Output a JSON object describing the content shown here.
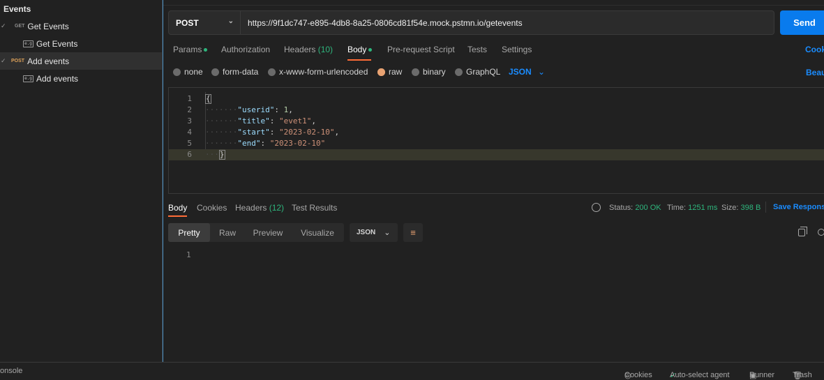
{
  "sidebar": {
    "collection_title": "Events",
    "items": [
      {
        "method": "GET",
        "label": "Get Events"
      },
      {
        "example_icon": "e.g",
        "label": "Get Events"
      },
      {
        "method": "POST",
        "label": "Add events"
      },
      {
        "example_icon": "e.g",
        "label": "Add events"
      }
    ]
  },
  "request": {
    "method": "POST",
    "url": "https://9f1dc747-e895-4db8-8a25-0806cd81f54e.mock.pstmn.io/getevents",
    "send_label": "Send"
  },
  "request_tabs": {
    "params": "Params",
    "authorization": "Authorization",
    "headers": "Headers",
    "headers_count": "(10)",
    "body": "Body",
    "pre_request": "Pre-request Script",
    "tests": "Tests",
    "settings": "Settings",
    "cookies_link": "Cooki"
  },
  "body_types": {
    "none": "none",
    "form_data": "form-data",
    "urlencoded": "x-www-form-urlencoded",
    "raw": "raw",
    "binary": "binary",
    "graphql": "GraphQL",
    "format": "JSON",
    "beautify_link": "Beau"
  },
  "editor": {
    "line_numbers": [
      "1",
      "2",
      "3",
      "4",
      "5",
      "6"
    ],
    "lines": [
      {
        "open": "{"
      },
      {
        "key": "\"userid\"",
        "sep": ": ",
        "value": "1",
        "type": "num",
        "trail": ","
      },
      {
        "key": "\"title\"",
        "sep": ": ",
        "value": "\"evet1\"",
        "type": "str",
        "trail": ","
      },
      {
        "key": "\"start\"",
        "sep": ": ",
        "value": "\"2023-02-10\"",
        "type": "str",
        "trail": ","
      },
      {
        "key": "\"end\"",
        "sep": ": ",
        "value": "\"2023-02-10\"",
        "type": "str",
        "trail": ""
      },
      {
        "close": "}"
      }
    ]
  },
  "response": {
    "tabs": {
      "body": "Body",
      "cookies": "Cookies",
      "headers": "Headers",
      "headers_count": "(12)",
      "test_results": "Test Results"
    },
    "status_label": "Status:",
    "status_value": "200 OK",
    "time_label": "Time:",
    "time_value": "1251 ms",
    "size_label": "Size:",
    "size_value": "398 B",
    "save_link": "Save Respons",
    "views": [
      "Pretty",
      "Raw",
      "Preview",
      "Visualize"
    ],
    "format": "JSON",
    "line_number": "1"
  },
  "footer": {
    "console": "onsole",
    "cookies": "Cookies",
    "auto_select": "Auto-select agent",
    "runner": "Runner",
    "trash": "Trash"
  },
  "colors": {
    "accent": "#ff6c37",
    "send": "#097bed",
    "status_ok": "#2eb67d",
    "link": "#1a8cff"
  }
}
